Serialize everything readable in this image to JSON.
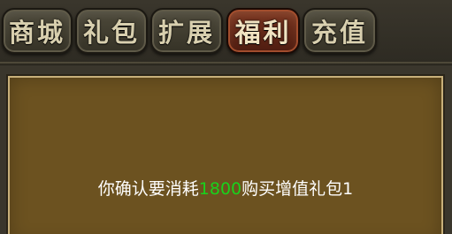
{
  "tabs": [
    {
      "label": "商城",
      "active": false
    },
    {
      "label": "礼包",
      "active": false
    },
    {
      "label": "扩展",
      "active": false
    },
    {
      "label": "福利",
      "active": true
    },
    {
      "label": "充值",
      "active": false
    }
  ],
  "dialog": {
    "prefix": "你确认要消耗",
    "amount": "1800",
    "suffix": "购买增值礼包1"
  },
  "colors": {
    "amount": "#19d21c",
    "active_tab": "#7a3520",
    "tab": "#4e4a3b",
    "panel": "#6c5220"
  }
}
